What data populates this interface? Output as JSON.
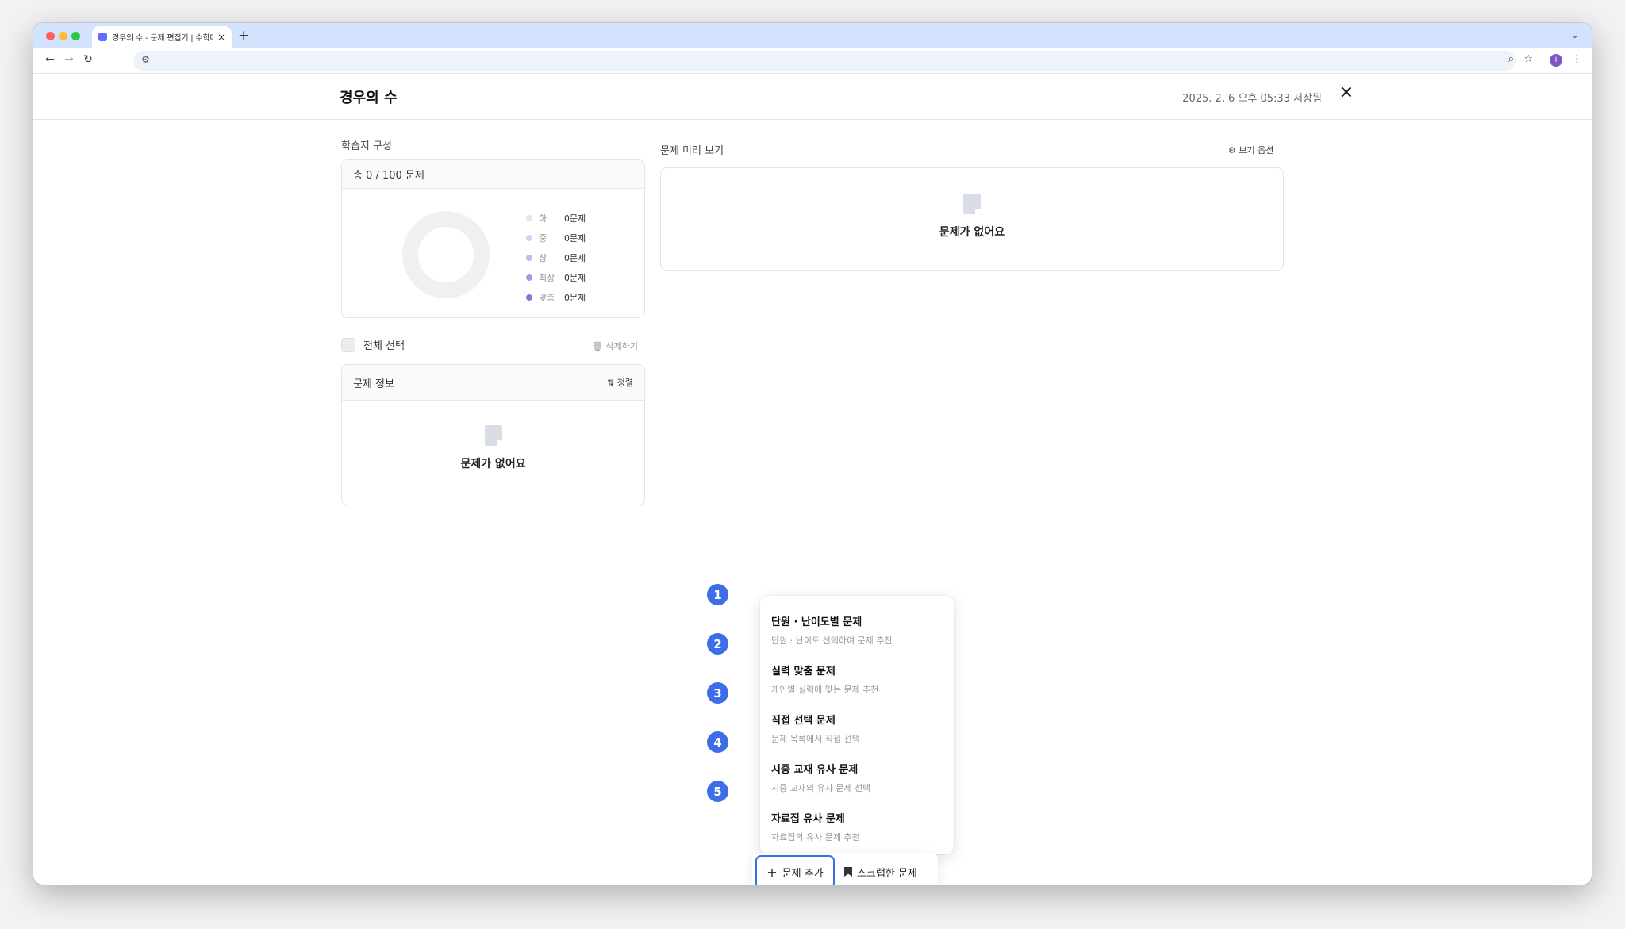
{
  "browser": {
    "tab_title": "경우의 수 - 문제 편집기 | 수학대왕",
    "tab_close": "×",
    "new_tab": "+",
    "dropdown": "⌄",
    "profile_initial": "I"
  },
  "header": {
    "title": "경우의 수",
    "saved_status": "2025. 2. 6 오후 05:33 저장됨",
    "close": "✕"
  },
  "composition": {
    "section_label": "학습지 구성",
    "total": "총 0 / 100 문제",
    "legend": [
      {
        "label": "하",
        "count": "0문제",
        "color": "#e7e4f8"
      },
      {
        "label": "중",
        "count": "0문제",
        "color": "#d6d0f3"
      },
      {
        "label": "상",
        "count": "0문제",
        "color": "#c3b9ee"
      },
      {
        "label": "최상",
        "count": "0문제",
        "color": "#a898e6"
      },
      {
        "label": "맞춤",
        "count": "0문제",
        "color": "#8b73dc"
      }
    ]
  },
  "selection": {
    "select_all": "전체 선택",
    "delete": "삭제하기"
  },
  "problem_info": {
    "title": "문제 정보",
    "sort": "정렬",
    "empty": "문제가 없어요"
  },
  "preview": {
    "title": "문제 미리 보기",
    "view_options": "보기 옵션",
    "empty": "문제가 없어요"
  },
  "add_menu": {
    "items": [
      {
        "num": "1",
        "title": "단원 · 난이도별 문제",
        "desc": "단원 · 난이도 선택하여 문제 추천"
      },
      {
        "num": "2",
        "title": "실력 맞춤 문제",
        "desc": "개인별 실력에 맞는 문제 추천"
      },
      {
        "num": "3",
        "title": "직접 선택 문제",
        "desc": "문제 목록에서 직접 선택"
      },
      {
        "num": "4",
        "title": "시중 교재 유사 문제",
        "desc": "시중 교재의 유사 문제 선택"
      },
      {
        "num": "5",
        "title": "자료집 유사 문제",
        "desc": "자료집의 유사 문제 추천"
      }
    ]
  },
  "actions": {
    "add_problem": "문제 추가",
    "scrapped": "스크랩한 문제"
  },
  "colors": {
    "accent": "#3d6ee8",
    "tab_strip": "#d3e3fd"
  }
}
